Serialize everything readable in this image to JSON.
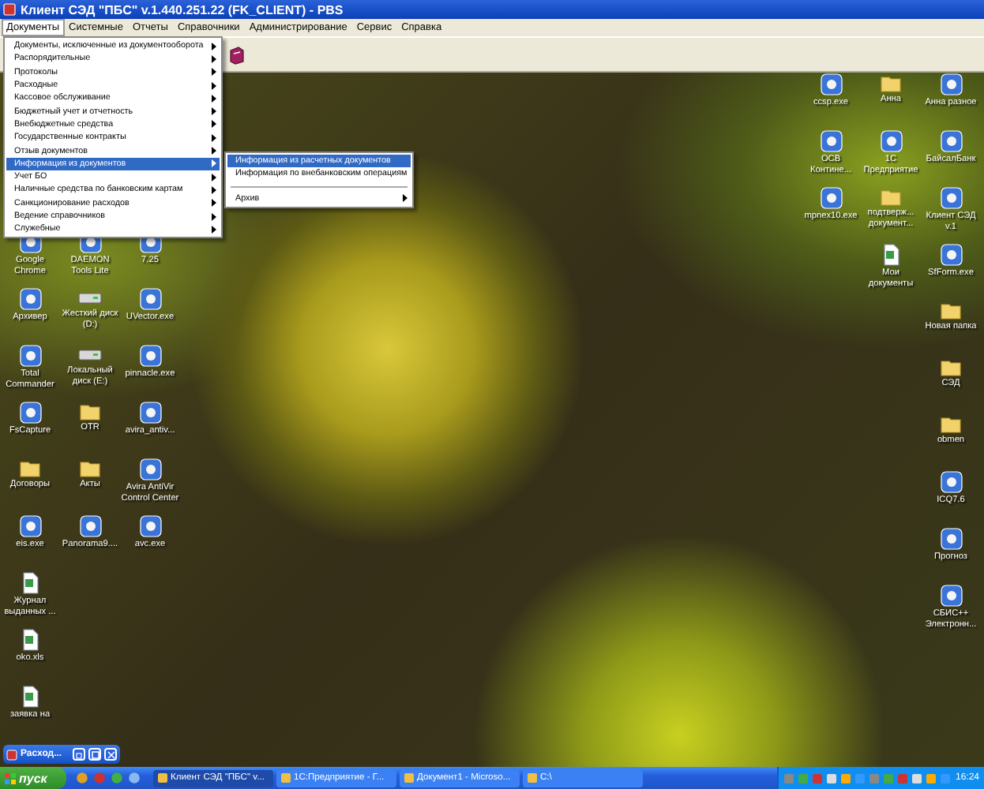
{
  "window": {
    "title": "Клиент СЭД \"ПБС\" v.1.440.251.22 (FK_CLIENT) - PBS"
  },
  "menu_bar": [
    {
      "label": "Документы",
      "selected": true
    },
    {
      "label": "Системные",
      "selected": false
    },
    {
      "label": "Отчеты",
      "selected": false
    },
    {
      "label": "Справочники",
      "selected": false
    },
    {
      "label": "Администрирование",
      "selected": false
    },
    {
      "label": "Сервис",
      "selected": false
    },
    {
      "label": "Справка",
      "selected": false
    }
  ],
  "dropdown": {
    "items": [
      {
        "label": "Документы, исключенные из документооборота",
        "selected": false
      },
      {
        "label": "Распорядительные",
        "selected": false
      },
      {
        "label": "Протоколы",
        "selected": false
      },
      {
        "label": "Расходные",
        "selected": false
      },
      {
        "label": "Кассовое обслуживание",
        "selected": false
      },
      {
        "label": "Бюджетный учет и отчетность",
        "selected": false
      },
      {
        "label": "Внебюджетные средства",
        "selected": false
      },
      {
        "label": "Государственные контракты",
        "selected": false
      },
      {
        "label": "Отзыв документов",
        "selected": false
      },
      {
        "label": "Информация из документов",
        "selected": true
      },
      {
        "label": "Учет БО",
        "selected": false
      },
      {
        "label": "Наличные средства по банковским картам",
        "selected": false
      },
      {
        "label": "Санкционирование расходов",
        "selected": false
      },
      {
        "label": "Ведение справочников",
        "selected": false
      },
      {
        "label": "Служебные",
        "selected": false
      }
    ]
  },
  "submenu": {
    "items": [
      {
        "kind": "item",
        "label": "Информация из расчетных документов",
        "selected": true
      },
      {
        "kind": "item",
        "label": "Информация по внебанковским операциям",
        "selected": false
      },
      {
        "kind": "separator"
      },
      {
        "kind": "submenu",
        "label": "Архив",
        "selected": false
      }
    ]
  },
  "desktop": {
    "left_columns": [
      [
        {
          "label": "Google Chrome",
          "kind": "app"
        },
        {
          "label": "Архивер",
          "kind": "app"
        },
        {
          "label": "Total Commander",
          "kind": "app"
        },
        {
          "label": "FsCapture",
          "kind": "app"
        },
        {
          "label": "Договоры",
          "kind": "folder"
        },
        {
          "label": "eis.exe",
          "kind": "app"
        },
        {
          "label": "Журнал выданных ...",
          "kind": "sheet"
        },
        {
          "label": "oko.xls",
          "kind": "sheet"
        },
        {
          "label": "заявка на",
          "kind": "sheet"
        }
      ],
      [
        {
          "label": "DAEMON Tools Lite",
          "kind": "app"
        },
        {
          "label": "Жесткий диск (D:)",
          "kind": "drive"
        },
        {
          "label": "Локальный диск (E:)",
          "kind": "drive"
        },
        {
          "label": "OTR",
          "kind": "folder"
        },
        {
          "label": "Акты",
          "kind": "folder"
        },
        {
          "label": "Panorama9....",
          "kind": "app"
        }
      ],
      [
        {
          "label": "7.25",
          "kind": "app"
        },
        {
          "label": "UVector.exe",
          "kind": "app"
        },
        {
          "label": "pinnacle.exe",
          "kind": "app"
        },
        {
          "label": "avira_antiv...",
          "kind": "app"
        },
        {
          "label": "Avira AntiVir Control Center",
          "kind": "app"
        },
        {
          "label": "avc.exe",
          "kind": "app"
        }
      ]
    ],
    "right_columns": [
      [
        {
          "label": "ccsp.exe",
          "kind": "app"
        },
        {
          "label": "ОСВ Контине...",
          "kind": "app"
        },
        {
          "label": "mpnex10.exe",
          "kind": "app"
        }
      ],
      [
        {
          "label": "Анна",
          "kind": "folder"
        },
        {
          "label": "1С Предприятие",
          "kind": "app"
        },
        {
          "label": "подтверж... документ...",
          "kind": "folder"
        },
        {
          "label": "Мои документы",
          "kind": "sheet"
        }
      ],
      [
        {
          "label": "Анна разное",
          "kind": "app"
        },
        {
          "label": "БайсалБанк",
          "kind": "app"
        },
        {
          "label": "Клиент СЭД v.1",
          "kind": "app"
        },
        {
          "label": "SfForm.exe",
          "kind": "app"
        },
        {
          "label": "Новая папка",
          "kind": "folder"
        },
        {
          "label": "СЭД",
          "kind": "folder"
        },
        {
          "label": "obmen",
          "kind": "folder"
        },
        {
          "label": "ICQ7.6",
          "kind": "app"
        },
        {
          "label": "Прогноз",
          "kind": "app"
        },
        {
          "label": "СБИС++ Электронн...",
          "kind": "app"
        }
      ]
    ]
  },
  "minimized_window": {
    "title": "Расход..."
  },
  "taskbar": {
    "start": "пуск",
    "tasks": [
      {
        "label": "Клиент СЭД \"ПБС\" v...",
        "selected": true
      },
      {
        "label": "1С:Предприятие - Г...",
        "selected": false
      },
      {
        "label": "Документ1 - Microso...",
        "selected": false
      },
      {
        "label": "C:\\",
        "selected": false
      }
    ],
    "clock": "16:24"
  }
}
